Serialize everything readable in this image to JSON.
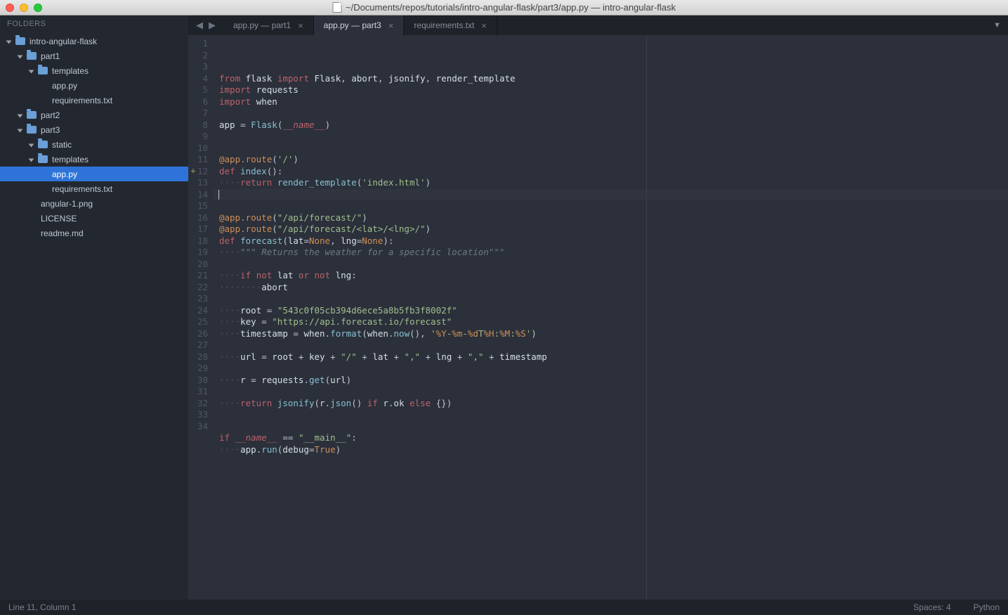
{
  "window": {
    "title": "~/Documents/repos/tutorials/intro-angular-flask/part3/app.py — intro-angular-flask"
  },
  "sidebar": {
    "header": "FOLDERS",
    "tree": [
      {
        "label": "intro-angular-flask",
        "type": "folder",
        "depth": 0,
        "open": true
      },
      {
        "label": "part1",
        "type": "folder",
        "depth": 1,
        "open": true
      },
      {
        "label": "templates",
        "type": "folder",
        "depth": 2,
        "open": false
      },
      {
        "label": "app.py",
        "type": "file",
        "depth": 3
      },
      {
        "label": "requirements.txt",
        "type": "file",
        "depth": 3
      },
      {
        "label": "part2",
        "type": "folder",
        "depth": 1,
        "open": false
      },
      {
        "label": "part3",
        "type": "folder",
        "depth": 1,
        "open": true
      },
      {
        "label": "static",
        "type": "folder",
        "depth": 2,
        "open": false
      },
      {
        "label": "templates",
        "type": "folder",
        "depth": 2,
        "open": false
      },
      {
        "label": "app.py",
        "type": "file",
        "depth": 3,
        "selected": true
      },
      {
        "label": "requirements.txt",
        "type": "file",
        "depth": 3
      },
      {
        "label": "angular-1.png",
        "type": "file",
        "depth": 2
      },
      {
        "label": "LICENSE",
        "type": "file",
        "depth": 2
      },
      {
        "label": "readme.md",
        "type": "file",
        "depth": 2
      }
    ]
  },
  "tabs": {
    "items": [
      {
        "label": "app.py — part1",
        "active": false
      },
      {
        "label": "app.py — part3",
        "active": true
      },
      {
        "label": "requirements.txt",
        "active": false
      }
    ]
  },
  "editor": {
    "gutter_modified_line": 12,
    "ruler_col": 80,
    "lines": [
      [
        [
          "kw",
          "from"
        ],
        [
          "sp",
          " "
        ],
        [
          "var",
          "flask"
        ],
        [
          "sp",
          " "
        ],
        [
          "kw",
          "import"
        ],
        [
          "sp",
          " "
        ],
        [
          "var",
          "Flask"
        ],
        [
          "op",
          ", "
        ],
        [
          "var",
          "abort"
        ],
        [
          "op",
          ", "
        ],
        [
          "var",
          "jsonify"
        ],
        [
          "op",
          ", "
        ],
        [
          "var",
          "render_template"
        ]
      ],
      [
        [
          "kw",
          "import"
        ],
        [
          "sp",
          " "
        ],
        [
          "var",
          "requests"
        ]
      ],
      [
        [
          "kw",
          "import"
        ],
        [
          "sp",
          " "
        ],
        [
          "var",
          "when"
        ]
      ],
      [],
      [
        [
          "var",
          "app"
        ],
        [
          "sp",
          " "
        ],
        [
          "op",
          "="
        ],
        [
          "sp",
          " "
        ],
        [
          "fn",
          "Flask"
        ],
        [
          "op",
          "("
        ],
        [
          "mag",
          "__name__"
        ],
        [
          "op",
          ")"
        ]
      ],
      [],
      [],
      [
        [
          "dec",
          "@app.route"
        ],
        [
          "op",
          "("
        ],
        [
          "str",
          "'/'"
        ],
        [
          "op",
          ")"
        ]
      ],
      [
        [
          "kw",
          "def"
        ],
        [
          "sp",
          " "
        ],
        [
          "fn",
          "index"
        ],
        [
          "op",
          "():"
        ]
      ],
      [
        [
          "dot",
          "····"
        ],
        [
          "kw",
          "return"
        ],
        [
          "sp",
          " "
        ],
        [
          "fn",
          "render_template"
        ],
        [
          "op",
          "("
        ],
        [
          "str",
          "'index.html'"
        ],
        [
          "op",
          ")"
        ]
      ],
      [
        [
          "caret",
          ""
        ]
      ],
      [],
      [
        [
          "dec",
          "@app.route"
        ],
        [
          "op",
          "("
        ],
        [
          "str",
          "\"/api/forecast/\""
        ],
        [
          "op",
          ")"
        ]
      ],
      [
        [
          "dec",
          "@app.route"
        ],
        [
          "op",
          "("
        ],
        [
          "str",
          "\"/api/forecast/<lat>/<lng>/\""
        ],
        [
          "op",
          ")"
        ]
      ],
      [
        [
          "kw",
          "def"
        ],
        [
          "sp",
          " "
        ],
        [
          "fn",
          "forecast"
        ],
        [
          "op",
          "("
        ],
        [
          "var",
          "lat"
        ],
        [
          "op",
          "="
        ],
        [
          "const",
          "None"
        ],
        [
          "op",
          ", "
        ],
        [
          "var",
          "lng"
        ],
        [
          "op",
          "="
        ],
        [
          "const",
          "None"
        ],
        [
          "op",
          "):"
        ]
      ],
      [
        [
          "dot",
          "····"
        ],
        [
          "cmt",
          "\"\"\" Returns the weather for a specific location\"\"\""
        ]
      ],
      [],
      [
        [
          "dot",
          "····"
        ],
        [
          "kw",
          "if"
        ],
        [
          "sp",
          " "
        ],
        [
          "kw",
          "not"
        ],
        [
          "sp",
          " "
        ],
        [
          "var",
          "lat"
        ],
        [
          "sp",
          " "
        ],
        [
          "kw",
          "or"
        ],
        [
          "sp",
          " "
        ],
        [
          "kw",
          "not"
        ],
        [
          "sp",
          " "
        ],
        [
          "var",
          "lng"
        ],
        [
          "op",
          ":"
        ]
      ],
      [
        [
          "dot",
          "········"
        ],
        [
          "var",
          "abort"
        ]
      ],
      [],
      [
        [
          "dot",
          "····"
        ],
        [
          "var",
          "root"
        ],
        [
          "sp",
          " "
        ],
        [
          "op",
          "="
        ],
        [
          "sp",
          " "
        ],
        [
          "str",
          "\"543c0f05cb394d6ece5a8b5fb3f8002f\""
        ]
      ],
      [
        [
          "dot",
          "····"
        ],
        [
          "var",
          "key"
        ],
        [
          "sp",
          " "
        ],
        [
          "op",
          "="
        ],
        [
          "sp",
          " "
        ],
        [
          "str",
          "\"https://api.forecast.io/forecast\""
        ]
      ],
      [
        [
          "dot",
          "····"
        ],
        [
          "var",
          "timestamp"
        ],
        [
          "sp",
          " "
        ],
        [
          "op",
          "="
        ],
        [
          "sp",
          " "
        ],
        [
          "var",
          "when"
        ],
        [
          "op",
          "."
        ],
        [
          "fn",
          "format"
        ],
        [
          "op",
          "("
        ],
        [
          "var",
          "when"
        ],
        [
          "op",
          "."
        ],
        [
          "fn",
          "now"
        ],
        [
          "op",
          "(), "
        ],
        [
          "str",
          "'"
        ],
        [
          "fmt",
          "%Y"
        ],
        [
          "str",
          "-"
        ],
        [
          "fmt",
          "%m"
        ],
        [
          "str",
          "-"
        ],
        [
          "fmt",
          "%d"
        ],
        [
          "str",
          "T"
        ],
        [
          "fmt",
          "%H"
        ],
        [
          "str",
          ":"
        ],
        [
          "fmt",
          "%M"
        ],
        [
          "str",
          ":"
        ],
        [
          "fmt",
          "%S"
        ],
        [
          "str",
          "'"
        ],
        [
          "op",
          ")"
        ]
      ],
      [],
      [
        [
          "dot",
          "····"
        ],
        [
          "var",
          "url"
        ],
        [
          "sp",
          " "
        ],
        [
          "op",
          "="
        ],
        [
          "sp",
          " "
        ],
        [
          "var",
          "root"
        ],
        [
          "sp",
          " "
        ],
        [
          "op",
          "+"
        ],
        [
          "sp",
          " "
        ],
        [
          "var",
          "key"
        ],
        [
          "sp",
          " "
        ],
        [
          "op",
          "+"
        ],
        [
          "sp",
          " "
        ],
        [
          "str",
          "\"/\""
        ],
        [
          "sp",
          " "
        ],
        [
          "op",
          "+"
        ],
        [
          "sp",
          " "
        ],
        [
          "var",
          "lat"
        ],
        [
          "sp",
          " "
        ],
        [
          "op",
          "+"
        ],
        [
          "sp",
          " "
        ],
        [
          "str",
          "\",\""
        ],
        [
          "sp",
          " "
        ],
        [
          "op",
          "+"
        ],
        [
          "sp",
          " "
        ],
        [
          "var",
          "lng"
        ],
        [
          "sp",
          " "
        ],
        [
          "op",
          "+"
        ],
        [
          "sp",
          " "
        ],
        [
          "str",
          "\",\""
        ],
        [
          "sp",
          " "
        ],
        [
          "op",
          "+"
        ],
        [
          "sp",
          " "
        ],
        [
          "var",
          "timestamp"
        ]
      ],
      [],
      [
        [
          "dot",
          "····"
        ],
        [
          "var",
          "r"
        ],
        [
          "sp",
          " "
        ],
        [
          "op",
          "="
        ],
        [
          "sp",
          " "
        ],
        [
          "var",
          "requests"
        ],
        [
          "op",
          "."
        ],
        [
          "fn",
          "get"
        ],
        [
          "op",
          "("
        ],
        [
          "var",
          "url"
        ],
        [
          "op",
          ")"
        ]
      ],
      [],
      [
        [
          "dot",
          "····"
        ],
        [
          "kw",
          "return"
        ],
        [
          "sp",
          " "
        ],
        [
          "fn",
          "jsonify"
        ],
        [
          "op",
          "("
        ],
        [
          "var",
          "r"
        ],
        [
          "op",
          "."
        ],
        [
          "fn",
          "json"
        ],
        [
          "op",
          "() "
        ],
        [
          "kw",
          "if"
        ],
        [
          "sp",
          " "
        ],
        [
          "var",
          "r"
        ],
        [
          "op",
          "."
        ],
        [
          "var",
          "ok"
        ],
        [
          "sp",
          " "
        ],
        [
          "kw",
          "else"
        ],
        [
          "sp",
          " "
        ],
        [
          "op",
          "{})"
        ]
      ],
      [],
      [],
      [
        [
          "kw",
          "if"
        ],
        [
          "sp",
          " "
        ],
        [
          "mag",
          "__name__"
        ],
        [
          "sp",
          " "
        ],
        [
          "op",
          "=="
        ],
        [
          "sp",
          " "
        ],
        [
          "str",
          "\"__main__\""
        ],
        [
          "op",
          ":"
        ]
      ],
      [
        [
          "dot",
          "····"
        ],
        [
          "var",
          "app"
        ],
        [
          "op",
          "."
        ],
        [
          "fn",
          "run"
        ],
        [
          "op",
          "("
        ],
        [
          "var",
          "debug"
        ],
        [
          "op",
          "="
        ],
        [
          "const",
          "True"
        ],
        [
          "op",
          ")"
        ]
      ],
      []
    ]
  },
  "statusbar": {
    "left": "Line 11, Column 1",
    "spaces": "Spaces: 4",
    "syntax": "Python"
  }
}
